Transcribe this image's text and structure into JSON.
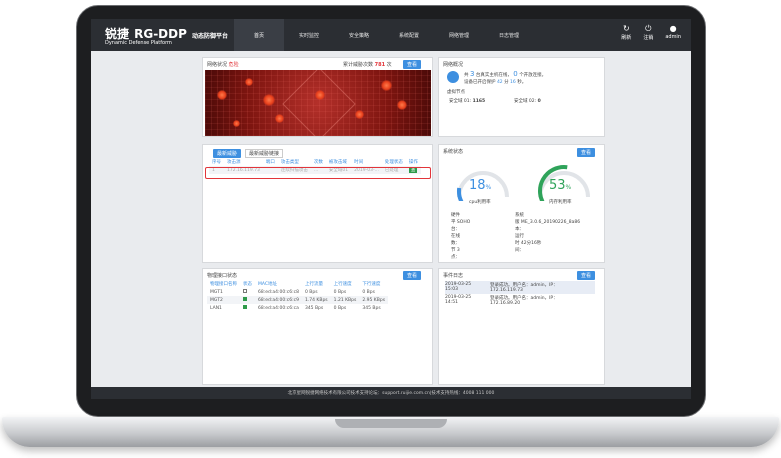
{
  "header": {
    "brand": "锐捷",
    "product": "RG-DDP",
    "product_cn": "动态防御平台",
    "product_en": "Dynamic Defense Platform",
    "tabs": [
      "首页",
      "实时监控",
      "安全策略",
      "系统配置",
      "网络管理",
      "日志管理"
    ],
    "active_tab": 0,
    "tools": [
      {
        "icon": "refresh-icon",
        "glyph": "↻",
        "label": "刷新"
      },
      {
        "icon": "power-icon",
        "glyph": "⏻",
        "label": "注销"
      },
      {
        "icon": "user-icon",
        "glyph": "●",
        "label": "admin"
      }
    ]
  },
  "network_status": {
    "title": "网络状况",
    "status_word": "危险",
    "threat_label": "累计威胁次数",
    "threat_count": "781",
    "threat_unit": "次",
    "view_label": "查看"
  },
  "network_overview": {
    "title": "网络概况",
    "line1_prefix": "共",
    "online_count": "3",
    "line1_mid": "台真实主机在线，",
    "open_count": "0",
    "line1_suffix": "个开放连接。",
    "line2_prefix": "设备已开启保护",
    "protect_minutes": "42",
    "protect_unit": "分",
    "protect_seconds": "16",
    "protect_sec_unit": "秒。",
    "virtual_title": "虚拟节点",
    "domain1": "安全域 01:",
    "domain1_val": "1165",
    "domain2": "安全域 02:",
    "domain2_val": "0"
  },
  "threat_list": {
    "tabs": [
      "最新威胁",
      "最新威胁链接"
    ],
    "headers": [
      "序号",
      "攻击源",
      "端口",
      "攻击类型",
      "次数",
      "被攻击域",
      "时间",
      "处理状态",
      "操作"
    ],
    "row": [
      "1",
      "172.16.119.73",
      "",
      "连续扫描攻击",
      "...",
      "安全域01",
      "2019-03-...",
      "已处理",
      "查"
    ]
  },
  "system_status": {
    "title": "系统状态",
    "view_label": "查看",
    "cpu_value": "18",
    "cpu_unit": "%",
    "cpu_label": "cpu利用率",
    "mem_value": "53",
    "mem_unit": "%",
    "mem_label": "内存利用率",
    "info_left": [
      "硬件",
      "  平 SOHO",
      "台：",
      "在线",
      "  数：",
      "  节 3",
      "点："
    ],
    "info_right": [
      "系统",
      "版 ME_3.0.6_20190226_8a86",
      "本：",
      "运行",
      "  时 42分16秒",
      "间："
    ]
  },
  "port_status": {
    "title": "物理接口状态",
    "view_label": "查看",
    "headers": [
      "物理接口名称",
      "状态",
      "MAC地址",
      "上行流量",
      "上行速度",
      "下行流量",
      "下行速度"
    ],
    "rows": [
      [
        "MGT1",
        "off",
        "68:ed:a4:00:c6:c8",
        "0 Bps",
        "0 Bps",
        "",
        "0 Bps"
      ],
      [
        "MGT2",
        "on",
        "68:ed:a4:00:c6:c9",
        "1.74 KBps",
        "1.21 KBps",
        "",
        "2.95 KBps"
      ],
      [
        "LAN1",
        "on",
        "68:ed:a4:00:c6:ca",
        "345 Bps",
        "0 Bps",
        "",
        "345 Bps"
      ]
    ]
  },
  "event_log": {
    "title": "事件日志",
    "view_label": "查看",
    "events": [
      {
        "date": "2019-03-25",
        "time": "15:03",
        "msg": "登录成功。用户名：admin，IP：",
        "ip": "172.16.119.73"
      },
      {
        "date": "2019-03-25",
        "time": "14:51",
        "msg": "登录成功。用户名：admin，IP：",
        "ip": "172.16.89.20"
      }
    ]
  },
  "footer": {
    "text": "北京星网锐捷网络技术有限公司技术支持论坛：support.ruijie.com.cn|技术支持热线：4008 111 000"
  },
  "colors": {
    "accent": "#3d8fe0",
    "danger": "#e2353a",
    "cpu_gauge": "#3d8fe0",
    "mem_gauge": "#2fa35a"
  }
}
